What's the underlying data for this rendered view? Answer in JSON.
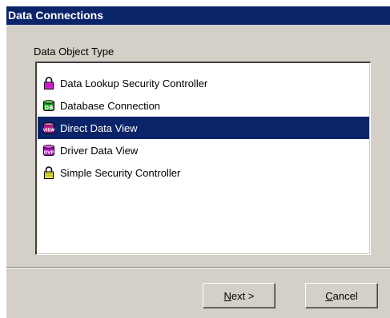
{
  "dialog": {
    "title": "Data Connections",
    "group_label": "Data Object Type",
    "items": [
      {
        "label": "Data Lookup Security Controller",
        "icon": "padlock-magenta-icon",
        "selected": false
      },
      {
        "label": "Database Connection",
        "icon": "database-db-icon",
        "selected": false
      },
      {
        "label": "Direct Data View",
        "icon": "view-icon",
        "selected": true
      },
      {
        "label": "Driver Data View",
        "icon": "driver-view-icon",
        "selected": false
      },
      {
        "label": "Simple Security Controller",
        "icon": "padlock-yellow-icon",
        "selected": false
      }
    ],
    "buttons": {
      "next_label": "Next >",
      "cancel_label": "Cancel"
    }
  },
  "colors": {
    "titlebar": "#0a246a",
    "selection": "#0a246a",
    "dialog_face": "#d4d0c8"
  }
}
